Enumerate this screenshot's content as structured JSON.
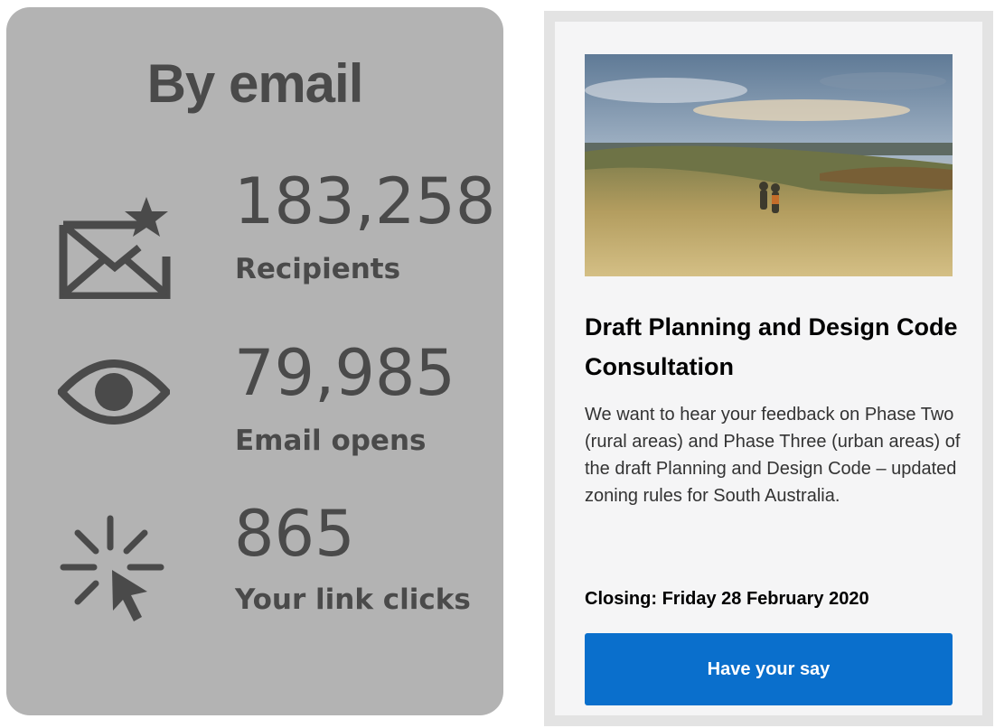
{
  "stats": {
    "title": "By email",
    "recipients": {
      "value": "183,258",
      "label": "Recipients",
      "icon": "mail-star-icon"
    },
    "opens": {
      "value": "79,985",
      "label": "Email opens",
      "icon": "eye-icon"
    },
    "clicks": {
      "value": "865",
      "label": "Your link clicks",
      "icon": "click-cursor-icon"
    }
  },
  "campaign": {
    "title": "Draft Planning and Design Code Consultation",
    "body": "We want to hear your feedback on Phase Two (rural areas) and Phase Three (urban areas) of the draft Planning and Design Code – updated zoning rules for South Australia.",
    "closing_label": "Closing",
    "closing_date": "Friday 28 February 2020",
    "button_label": "Have your say"
  },
  "colors": {
    "stats_bg": "#b3b3b3",
    "stats_text": "#4a4a4a",
    "button_bg": "#0a6fcc"
  }
}
